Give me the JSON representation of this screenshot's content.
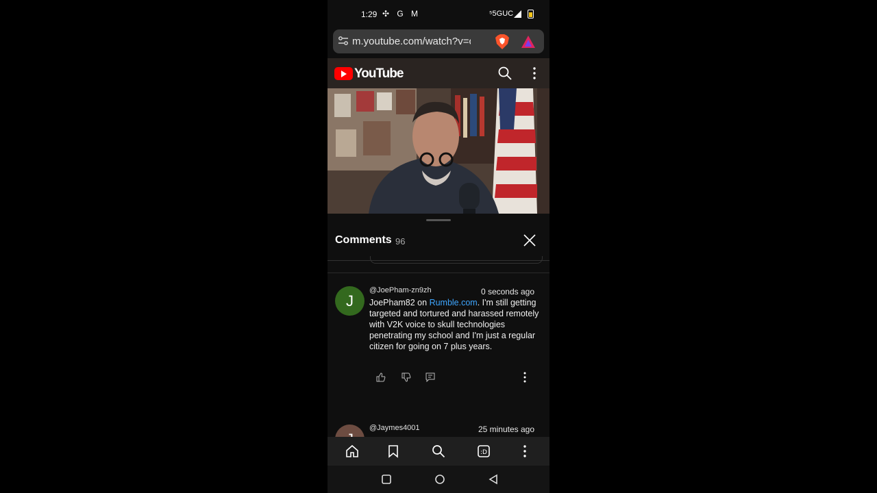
{
  "status": {
    "time": "1:29",
    "left_icons": "✣ G M",
    "network": "⁵5GUC"
  },
  "browser": {
    "url": "m.youtube.com/watch?v=cyHq"
  },
  "youtube": {
    "wordmark": "YouTube"
  },
  "comments": {
    "title": "Comments",
    "count": "96",
    "items": [
      {
        "avatar_letter": "J",
        "avatar_color": "#33691e",
        "author": "@JoePham-zn9zh",
        "time": "0 seconds ago",
        "text_before_link": "JoePham82 on ",
        "link": "Rumble.com",
        "text_after_link": ". I'm still getting targeted and tortured and harassed remotely with V2K voice to skull technologies penetrating my school and I'm just a regular citizen for going on 7 plus years."
      },
      {
        "avatar_letter": "J",
        "avatar_color": "#6d4c41",
        "author": "@Jaymes4001",
        "time": "25 minutes ago"
      }
    ]
  },
  "colors": {
    "link": "#3ea6ff",
    "yt_red": "#ff0000"
  }
}
